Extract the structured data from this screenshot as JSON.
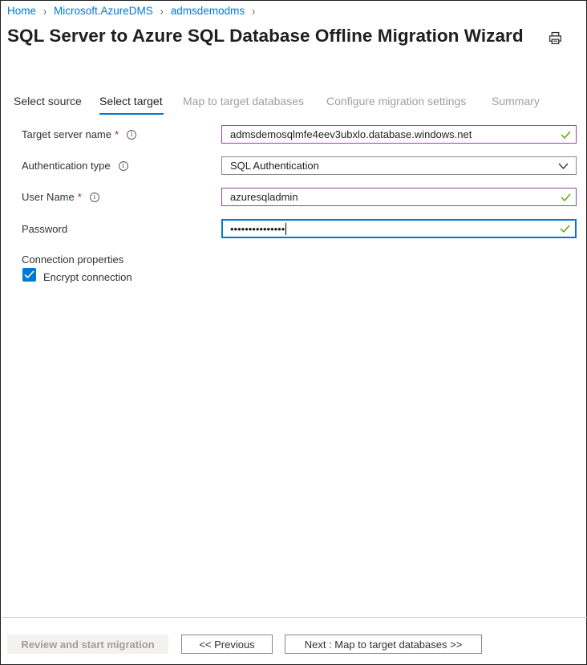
{
  "breadcrumb": {
    "items": [
      "Home",
      "Microsoft.AzureDMS",
      "admsdemodms"
    ]
  },
  "title": "SQL Server to Azure SQL Database Offline Migration Wizard",
  "tabs": [
    {
      "label": "Select source",
      "state": "done"
    },
    {
      "label": "Select target",
      "state": "active"
    },
    {
      "label": "Map to target databases",
      "state": "disabled"
    },
    {
      "label": "Configure migration settings",
      "state": "disabled"
    },
    {
      "label": "Summary",
      "state": "disabled"
    }
  ],
  "form": {
    "target_server": {
      "label": "Target server name",
      "required": true,
      "value": "admsdemosqlmfe4eev3ubxlo.database.windows.net"
    },
    "auth_type": {
      "label": "Authentication type",
      "value": "SQL Authentication"
    },
    "user_name": {
      "label": "User Name",
      "required": true,
      "value": "azuresqladmin"
    },
    "password": {
      "label": "Password",
      "masked_value": "•••••••••••••••"
    },
    "connection_properties_label": "Connection properties",
    "encrypt_connection": {
      "label": "Encrypt connection",
      "checked": true
    }
  },
  "required_marker": "*",
  "info_glyph": "i",
  "footer": {
    "review_label": "Review and start migration",
    "previous_label": "<< Previous",
    "next_label": "Next : Map to target databases >>"
  },
  "colors": {
    "accent": "#0078d4",
    "valid_border": "#8f46a5",
    "valid_check": "#57a300",
    "required": "#a4262c",
    "disabled_text": "#a19f9d"
  },
  "icons": [
    "chevron-right-icon",
    "print-icon",
    "info-icon",
    "checkmark-icon",
    "chevron-down-icon"
  ]
}
